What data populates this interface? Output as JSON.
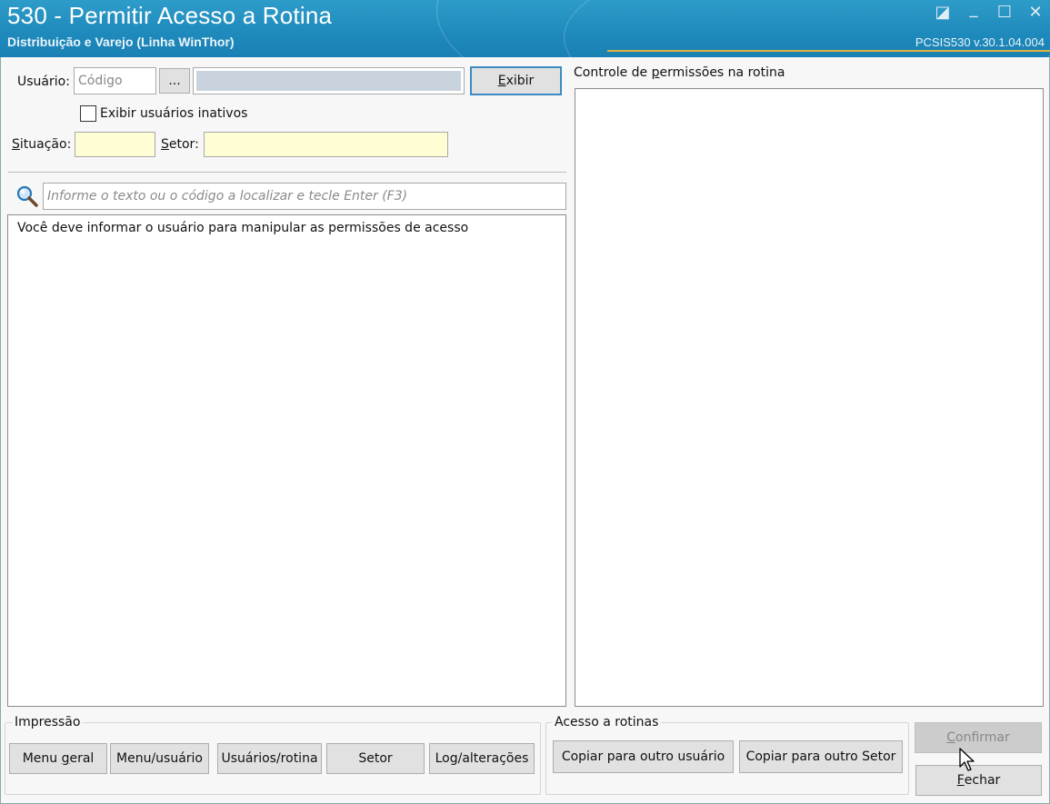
{
  "window": {
    "title": "530 - Permitir Acesso a Rotina",
    "subtitle": "Distribuição e Varejo (Linha WinThor)",
    "version": "PCSIS530  v.30.1.04.004",
    "controls": {
      "restore": "◪",
      "minimize": "_",
      "maximize": "☐",
      "close": "✕"
    }
  },
  "filters": {
    "usuario_label": "Usuário:",
    "codigo_placeholder": "Código",
    "browse_label": "...",
    "user_name_value": "",
    "exibir_first": "E",
    "exibir_rest": "xibir",
    "inativos_label": "Exibir usuários inativos",
    "situacao_first": "S",
    "situacao_rest": "ituação:",
    "setor_first": "S",
    "setor_rest": "etor:"
  },
  "search": {
    "placeholder": "Informe o texto ou o código a localizar e tecle Enter (F3)",
    "icon": "search-icon"
  },
  "list": {
    "message": "Você deve informar o usuário para manipular as permissões de acesso"
  },
  "permissions": {
    "title_pre": "Controle de ",
    "title_u": "p",
    "title_post": "ermissões na rotina"
  },
  "impressao": {
    "title": "Impressão",
    "menu_geral_pre": "Menu ",
    "menu_geral_u": "g",
    "menu_geral_post": "eral",
    "menu_usuario": "Menu/usuário",
    "usuarios_rotina": "Usuários/rotina",
    "setor": "Setor",
    "log": "Log/alterações"
  },
  "acesso": {
    "title": "Acesso a rotinas",
    "copiar_usuario": "Copiar para outro usuário",
    "copiar_setor": "Copiar para outro Setor"
  },
  "actions": {
    "confirmar_first": "C",
    "confirmar_rest": "onfirmar",
    "fechar_first": "F",
    "fechar_rest": "echar"
  },
  "colors": {
    "titlebar": "#1f8bbd",
    "accent_line": "#e0b040",
    "yellow_field": "#fffdd3",
    "focus_border": "#3c8cc4"
  }
}
